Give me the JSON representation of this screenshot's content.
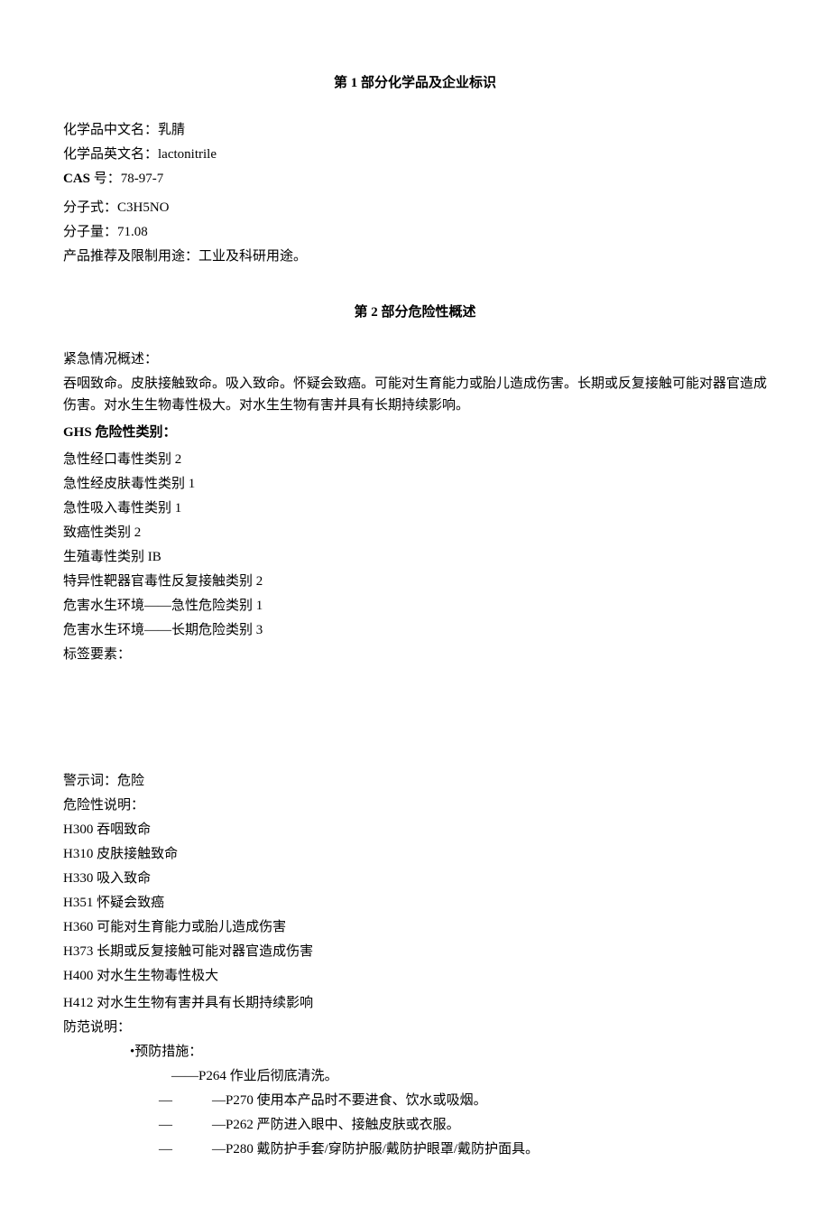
{
  "section1": {
    "title_prefix": "第 ",
    "title_num": "1",
    "title_suffix": " 部分化学品及企业标识",
    "cn_name_label": "化学品中文名：",
    "cn_name_value": "乳腈",
    "en_name_label": "化学品英文名：",
    "en_name_value": "lactonitrile",
    "cas_label": "CAS ",
    "cas_label2": "号：",
    "cas_value": "78-97-7",
    "formula_label": "分子式：",
    "formula_value": "C3H5NO",
    "mw_label": "分子量：",
    "mw_value": "71.08",
    "use_label": "产品推荐及限制用途：",
    "use_value": "工业及科研用途。"
  },
  "section2": {
    "title_prefix": "第 ",
    "title_num": "2",
    "title_suffix": " 部分危险性概述",
    "emergency_label": "紧急情况概述：",
    "emergency_text": "吞咽致命。皮肤接触致命。吸入致命。怀疑会致癌。可能对生育能力或胎儿造成伤害。长期或反复接触可能对器官造成伤害。对水生生物毒性极大。对水生生物有害并具有长期持续影响。",
    "ghs_label_en": "GHS ",
    "ghs_label_cn": "危险性类别：",
    "ghs_items": [
      "急性经口毒性类别 2",
      "急性经皮肤毒性类别 1",
      "急性吸入毒性类别 1",
      "致癌性类别 2",
      "生殖毒性类别 IB",
      "特异性靶器官毒性反复接触类别 2",
      "危害水生环境——急性危险类别 1",
      "危害水生环境——长期危险类别 3"
    ],
    "label_elements": "标签要素：",
    "signal_word_label": "警示词：",
    "signal_word_value": "危险",
    "hazard_statement_label": "危险性说明：",
    "hazard_items": [
      "H300 吞咽致命",
      "H310 皮肤接触致命",
      "H330 吸入致命",
      "H351 怀疑会致癌",
      "H360 可能对生育能力或胎儿造成伤害",
      "H373 长期或反复接触可能对器官造成伤害",
      "H400 对水生生物毒性极大",
      "H412 对水生生物有害并具有长期持续影响"
    ],
    "precaution_label": "防范说明：",
    "prevention_head": "•预防措施：",
    "prevention_items": [
      "——P264 作业后彻底清洗。",
      "—P270 使用本产品时不要进食、饮水或吸烟。",
      "—P262 严防进入眼中、接触皮肤或衣服。",
      "—P280 戴防护手套/穿防护服/戴防护眼罩/戴防护面具。"
    ]
  }
}
